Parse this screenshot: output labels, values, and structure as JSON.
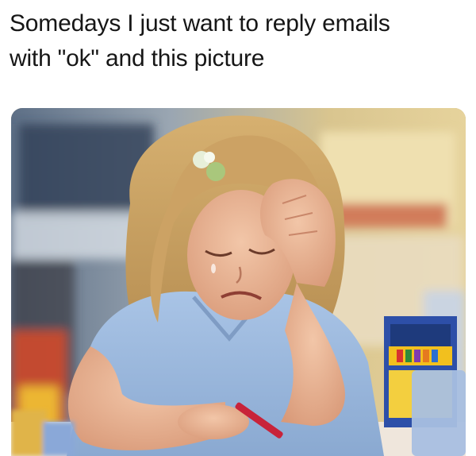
{
  "meme": {
    "caption_line_1": "Somedays I just want to reply emails",
    "caption_line_2": "with \"ok\" and this picture"
  },
  "photo": {
    "subject": "crying-girl-doing-homework",
    "box_label": "CRAYONS"
  }
}
